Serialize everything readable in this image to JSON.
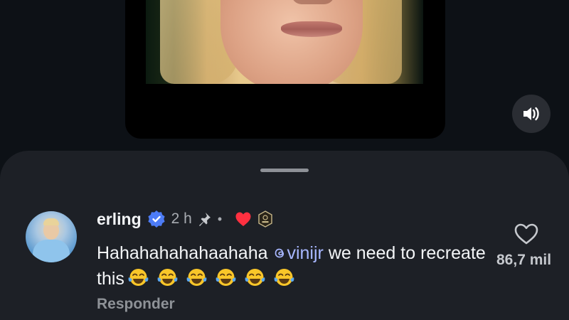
{
  "comment": {
    "username": "erling",
    "time": "2 h",
    "separator": "•",
    "text_before": "Hahahahahahaahaha ",
    "mention": "vinijr",
    "text_after": " we need to recreate this",
    "emoji_count": 6,
    "reply_label": "Responder",
    "like_count": "86,7 mil"
  },
  "icons": {
    "verified": "verified-badge-icon",
    "pin": "pin-icon",
    "heart": "heart-icon",
    "badge": "creator-badge-icon",
    "like": "heart-outline-icon",
    "sound": "speaker-icon",
    "mention": "threads-icon",
    "emoji": "tears-of-joy-emoji"
  },
  "colors": {
    "background": "#0d1116",
    "sheet": "#1d2026",
    "verified_blue": "#4d7cf6",
    "heart_red": "#ff3040",
    "mention": "#a8b7ff"
  }
}
